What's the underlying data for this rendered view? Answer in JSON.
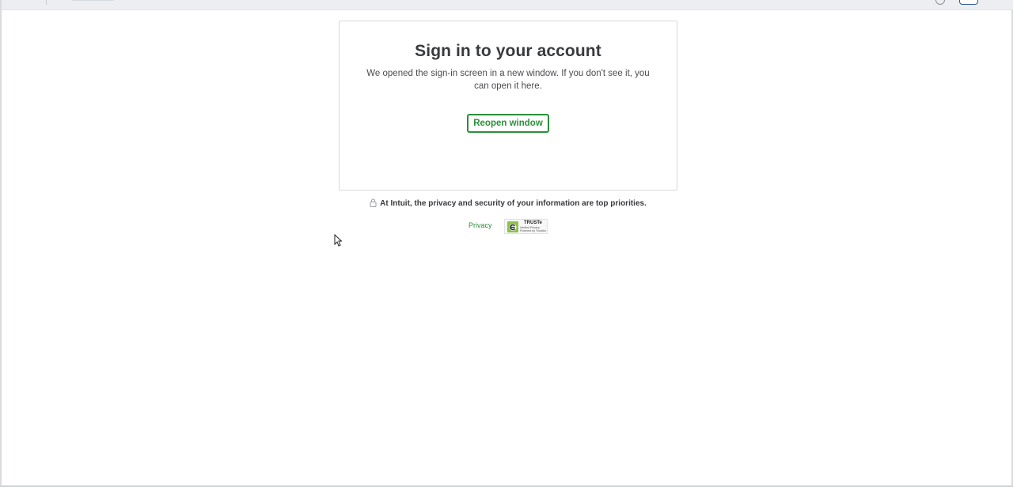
{
  "card": {
    "title": "Sign in to your account",
    "message": "We opened the sign-in screen in a new window. If you don't see it, you can open it here.",
    "reopen_label": "Reopen window"
  },
  "footer": {
    "security_text": "At Intuit, the privacy and security of your information are top priorities.",
    "privacy_link": "Privacy",
    "truste_label": "TRUSTe",
    "truste_sub": "Verified Privacy Powered by TrustArc"
  },
  "icons": {
    "lock": "lock-icon",
    "truste": "truste-badge-icon",
    "cursor": "mouse-pointer-icon"
  },
  "colors": {
    "accent_green": "#2c8f3b",
    "title_text": "#393a3d",
    "topbar_bg": "#eceef1"
  }
}
